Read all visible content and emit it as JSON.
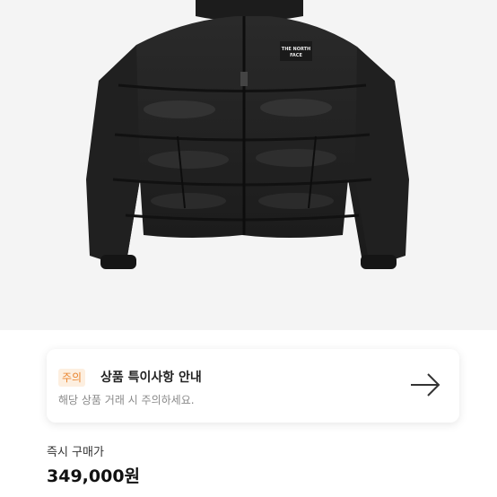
{
  "product": {
    "image_description": "jacket-photo",
    "logo_text": "THE NORTH FACE"
  },
  "notice": {
    "badge": "주의",
    "title": "상품 특이사항 안내",
    "description": "해당 상품 거래 시 주의하세요.",
    "badge_bg": "#fdefe0",
    "badge_color": "#e9852f",
    "arrow_icon": "arrow-right-icon"
  },
  "price": {
    "label": "즉시 구매가",
    "value": "349,000원"
  }
}
